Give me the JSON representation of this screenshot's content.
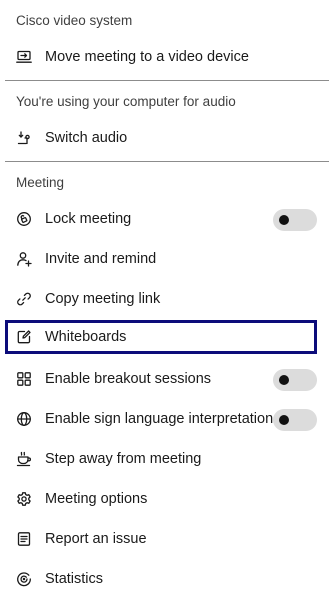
{
  "sections": {
    "video": {
      "header": "Cisco video system",
      "move_to_device": "Move meeting to a video device"
    },
    "audio": {
      "header": "You're using your computer for audio",
      "switch_audio": "Switch audio"
    },
    "meeting": {
      "header": "Meeting",
      "lock_meeting": "Lock meeting",
      "invite_and_remind": "Invite and remind",
      "copy_meeting_link": "Copy meeting link",
      "whiteboards": "Whiteboards",
      "enable_breakout_sessions": "Enable breakout sessions",
      "enable_sign_language": "Enable sign language interpretation",
      "step_away": "Step away from meeting",
      "meeting_options": "Meeting options",
      "report_issue": "Report an issue",
      "statistics": "Statistics"
    }
  },
  "toggles": {
    "lock_meeting": false,
    "enable_breakout_sessions": false,
    "enable_sign_language": false
  },
  "icons": {
    "move_to_device": "laptop-arrow-icon",
    "switch_audio": "switch-audio-icon",
    "lock_meeting": "lock-meeting-icon",
    "invite_and_remind": "invite-person-icon",
    "copy_meeting_link": "link-icon",
    "whiteboards": "whiteboard-icon",
    "enable_breakout_sessions": "breakout-grid-icon",
    "enable_sign_language": "globe-icon",
    "step_away": "coffee-cup-icon",
    "meeting_options": "gear-icon",
    "report_issue": "report-document-icon",
    "statistics": "statistics-icon"
  },
  "colors": {
    "focus_outline": "#0c0c7a",
    "toggle_off_track": "#dcdcdc",
    "toggle_knob": "#111111",
    "divider": "#8c8c8c"
  }
}
